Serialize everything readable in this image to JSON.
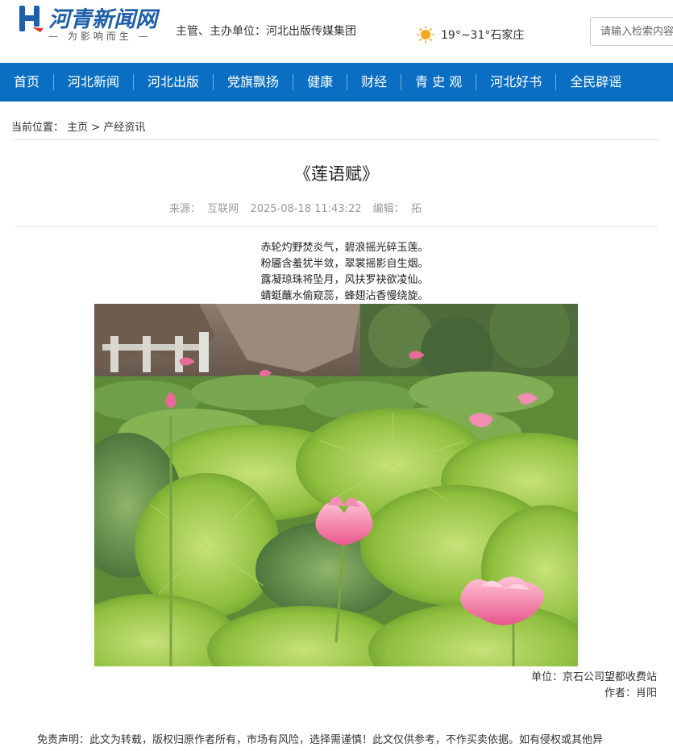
{
  "header": {
    "logo_text": "河青新闻网",
    "logo_slogan": "为影响而生",
    "organizer": "主管、主办单位：河北出版传媒集团",
    "weather": "19°~31°石家庄",
    "search_placeholder": "请输入检索内容"
  },
  "nav": {
    "items": [
      {
        "label": "首页"
      },
      {
        "label": "河北新闻"
      },
      {
        "label": "河北出版"
      },
      {
        "label": "党旗飘扬"
      },
      {
        "label": "健康"
      },
      {
        "label": "财经"
      },
      {
        "label": "青 史 观"
      },
      {
        "label": "河北好书"
      },
      {
        "label": "全民辟谣"
      }
    ]
  },
  "breadcrumb": {
    "prefix": "当前位置：",
    "home": "主页",
    "separator": ">",
    "section": "产经资讯"
  },
  "article": {
    "title": "《莲语赋》",
    "source_label": "来源：",
    "source": "互联网",
    "datetime": "2025-08-18 11:43:22",
    "editor_label": "编辑：",
    "editor": "拓",
    "poem": [
      "赤轮灼野焚炎气，碧浪摇光碎玉莲。",
      "粉靥含羞犹半敛，翠裳摇影自生烟。",
      "露凝琼珠将坠月，风扶罗袂欲凌仙。",
      "蜻蜓蘸水偷窥蕊，蜂翅沾香慢绕旋。"
    ],
    "unit": "单位：京石公司望都收费站",
    "author": "作者：肖阳",
    "disclaimer": "免责声明：此文为转载，版权归原作者所有，市场有风险，选择需谨慎！此文仅供参考，不作买卖依据。如有侵权或其他异"
  },
  "colors": {
    "brand_blue": "#0a6fc2",
    "logo_blue": "#1d5fa8",
    "sun_orange": "#f7a81b"
  }
}
